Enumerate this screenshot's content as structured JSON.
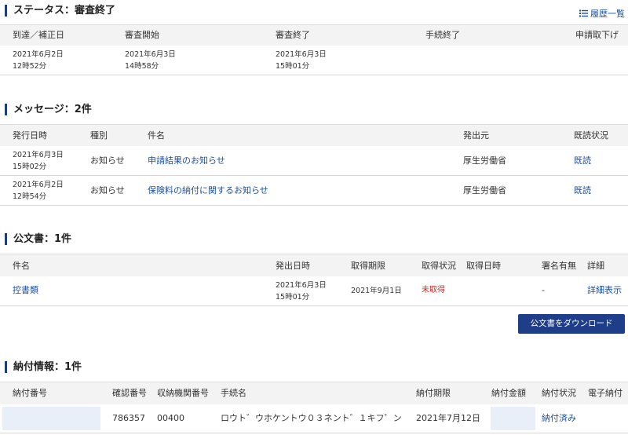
{
  "status": {
    "title": "ステータス：審査終了",
    "history_link": "履歴一覧",
    "headers": [
      "到達／補正日",
      "審査開始",
      "審査終了",
      "手続終了",
      "申請取下げ"
    ],
    "row": {
      "arrival_date": "2021年6月2日",
      "arrival_time": "12時52分",
      "start_date": "2021年6月3日",
      "start_time": "14時58分",
      "end_date": "2021年6月3日",
      "end_time": "15時01分"
    }
  },
  "messages": {
    "title": "メッセージ：2件",
    "headers": [
      "発行日時",
      "種別",
      "件名",
      "発出元",
      "既読状況"
    ],
    "rows": [
      {
        "date": "2021年6月3日",
        "time": "15時02分",
        "type": "お知らせ",
        "subject": "申請結果のお知らせ",
        "sender": "厚生労働省",
        "status": "既読"
      },
      {
        "date": "2021年6月2日",
        "time": "12時54分",
        "type": "お知らせ",
        "subject": "保険料の納付に関するお知らせ",
        "sender": "厚生労働省",
        "status": "既読"
      }
    ]
  },
  "documents": {
    "title": "公文書：1件",
    "headers": [
      "件名",
      "発出日時",
      "取得期限",
      "取得状況",
      "取得日時",
      "署名有無",
      "詳細"
    ],
    "row": {
      "name": "控書類",
      "issued_date": "2021年6月3日",
      "issued_time": "15時01分",
      "deadline": "2021年9月1日",
      "status": "未取得",
      "signature": "-",
      "detail": "詳細表示"
    },
    "download_button": "公文書をダウンロード"
  },
  "payment": {
    "title": "納付情報：1件",
    "headers": [
      "納付番号",
      "確認番号",
      "収納機関番号",
      "手続名",
      "納付期限",
      "納付金額",
      "納付状況",
      "電子納付"
    ],
    "row": {
      "confirm_no": "786357",
      "agency_no": "00400",
      "procedure": "ロウト゛ウホケントウ０３ネント゛１キフ゜ン",
      "deadline": "2021年7月12日",
      "status": "納付済み"
    }
  }
}
